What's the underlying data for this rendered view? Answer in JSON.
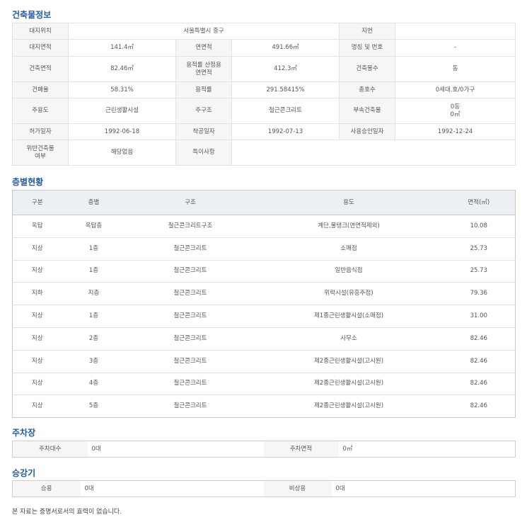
{
  "building": {
    "title": "건축물정보",
    "site_location_label": "대지위치",
    "site_location_value": "서울특별시 중구",
    "lot_number_label": "지번",
    "lot_number_value": "",
    "site_area_label": "대지면적",
    "site_area_value": "141.4㎡",
    "floor_area_label": "연면적",
    "floor_area_value": "491.66㎡",
    "name_number_label": "명칭 및 번호",
    "name_number_value": "-",
    "building_area_label": "건축면적",
    "building_area_value": "82.46㎡",
    "far_calc_area_label_1": "용적률 산정용",
    "far_calc_area_label_2": "연면적",
    "far_calc_area_value": "412.3㎡",
    "building_count_label": "건축물수",
    "building_count_value": "동",
    "coverage_label": "건폐율",
    "coverage_value": "58.31%",
    "far_label": "용적률",
    "far_value": "291.58415%",
    "total_units_label": "총호수",
    "total_units_value": "0세대.호/0가구",
    "main_use_label": "주용도",
    "main_use_value": "근린생활시설",
    "main_structure_label": "주구조",
    "main_structure_value": "철근콘크리트",
    "annex_label": "부속건축물",
    "annex_value_1": "0동",
    "annex_value_2": "0㎡",
    "permit_date_label": "허가일자",
    "permit_date_value": "1992-06-18",
    "start_date_label": "착공일자",
    "start_date_value": "1992-07-13",
    "approval_date_label": "사용승인일자",
    "approval_date_value": "1992-12-24",
    "violation_label_1": "위반건축물",
    "violation_label_2": "여부",
    "violation_value": "해당없음",
    "remarks_label": "특이사항",
    "remarks_value": ""
  },
  "floors": {
    "title": "층별현황",
    "headers": {
      "division": "구분",
      "floor": "층별",
      "structure": "구조",
      "use": "용도",
      "area": "면적(㎡)"
    },
    "rows": [
      {
        "division": "옥탑",
        "floor": "옥탑층",
        "structure": "철근콘크리트구조",
        "use": "계단,물탱크(연면적제외)",
        "area": "10.08"
      },
      {
        "division": "지상",
        "floor": "1층",
        "structure": "철근콘크리트",
        "use": "소매점",
        "area": "25.73"
      },
      {
        "division": "지상",
        "floor": "1층",
        "structure": "철근콘크리트",
        "use": "일반음식점",
        "area": "25.73"
      },
      {
        "division": "지하",
        "floor": "지층",
        "structure": "철근콘크리트",
        "use": "위락시설(유흥주점)",
        "area": "79.36"
      },
      {
        "division": "지상",
        "floor": "1층",
        "structure": "철근콘크리트",
        "use": "제1종근린생활시설(소매점)",
        "area": "31.00"
      },
      {
        "division": "지상",
        "floor": "2층",
        "structure": "철근콘크리트",
        "use": "사무소",
        "area": "82.46"
      },
      {
        "division": "지상",
        "floor": "3층",
        "structure": "철근콘크리트",
        "use": "제2종근린생활시설(고시원)",
        "area": "82.46"
      },
      {
        "division": "지상",
        "floor": "4층",
        "structure": "철근콘크리트",
        "use": "제2종근린생활시설(고시원)",
        "area": "82.46"
      },
      {
        "division": "지상",
        "floor": "5층",
        "structure": "철근콘크리트",
        "use": "제2종근린생활시설(고시원)",
        "area": "82.46"
      }
    ]
  },
  "parking": {
    "title": "주차장",
    "count_label": "주차대수",
    "count_value": "0대",
    "area_label": "주차면적",
    "area_value": "0㎡"
  },
  "elevator": {
    "title": "승강기",
    "passenger_label": "승용",
    "passenger_value": "0대",
    "emergency_label": "비상용",
    "emergency_value": "0대"
  },
  "notice": "본 자료는 증명서로서의 효력이 없습니다."
}
